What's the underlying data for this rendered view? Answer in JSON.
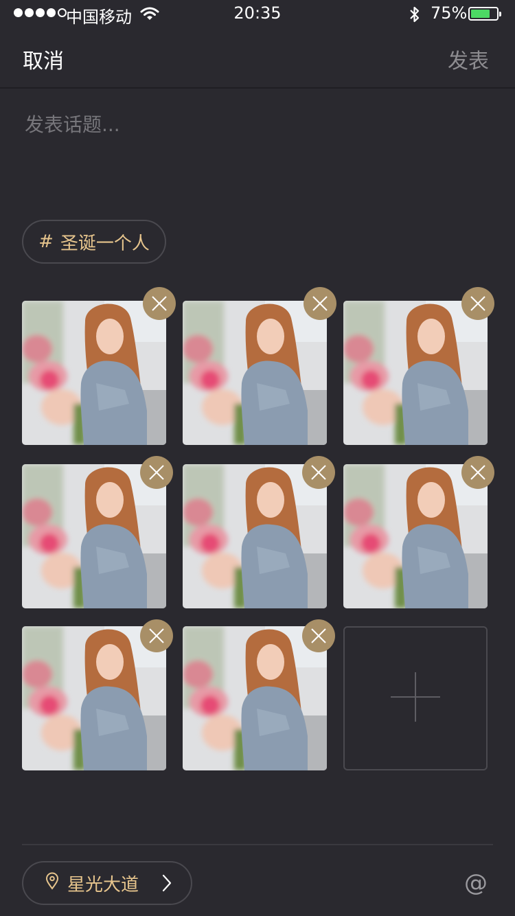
{
  "status_bar": {
    "carrier": "中国移动",
    "time": "20:35",
    "battery": "75%",
    "battery_level": 0.75
  },
  "nav": {
    "cancel": "取消",
    "publish": "发表"
  },
  "composer": {
    "placeholder": "发表话题..."
  },
  "hashtag": {
    "symbol": "#",
    "label": "圣诞一个人"
  },
  "photos": {
    "count": 8,
    "add_icon": "plus-icon",
    "remove_icon": "close-icon"
  },
  "location": {
    "label": "星光大道"
  },
  "mention": {
    "symbol": "@"
  },
  "colors": {
    "background": "#2a292f",
    "accent": "#e7c58d",
    "remove_badge": "#a88f67",
    "battery": "#4cd964"
  }
}
